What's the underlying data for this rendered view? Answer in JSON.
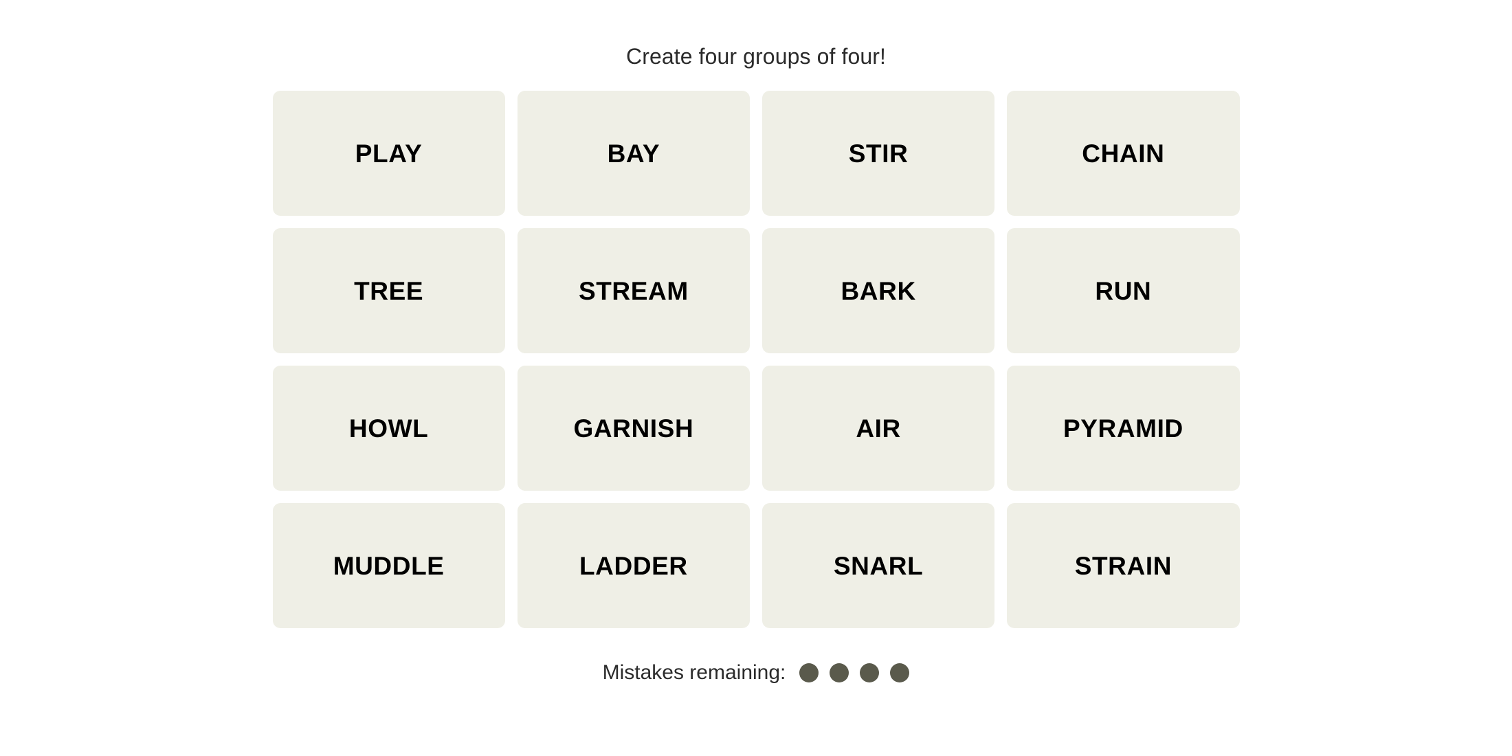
{
  "page": {
    "background_color": "#ffffff",
    "instruction": "Create four groups of four!"
  },
  "grid": {
    "columns": 4,
    "rows": 4,
    "tile_background_color": "#EFEFE6",
    "tile_text_color": "#000000",
    "tiles": [
      {
        "label": "PLAY"
      },
      {
        "label": "BAY"
      },
      {
        "label": "STIR"
      },
      {
        "label": "CHAIN"
      },
      {
        "label": "TREE"
      },
      {
        "label": "STREAM"
      },
      {
        "label": "BARK"
      },
      {
        "label": "RUN"
      },
      {
        "label": "HOWL"
      },
      {
        "label": "GARNISH"
      },
      {
        "label": "AIR"
      },
      {
        "label": "PYRAMID"
      },
      {
        "label": "MUDDLE"
      },
      {
        "label": "LADDER"
      },
      {
        "label": "SNARL"
      },
      {
        "label": "STRAIN"
      }
    ]
  },
  "mistakes": {
    "label": "Mistakes remaining:",
    "remaining": 4,
    "dot_color": "#5A5A4C",
    "dots": [
      {
        "name": "mistake-dot-1"
      },
      {
        "name": "mistake-dot-2"
      },
      {
        "name": "mistake-dot-3"
      },
      {
        "name": "mistake-dot-4"
      }
    ]
  }
}
